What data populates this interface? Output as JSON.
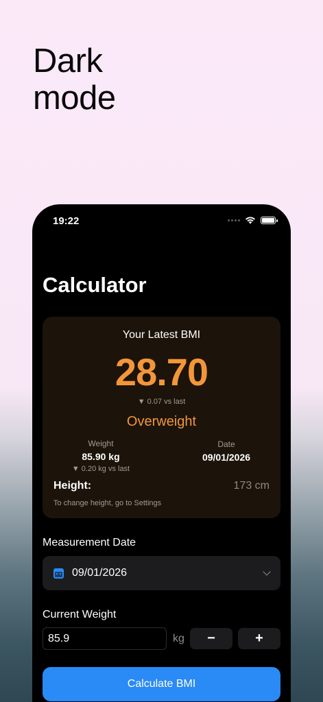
{
  "promo": {
    "line1": "Dark",
    "line2": "mode"
  },
  "status_bar": {
    "time": "19:22"
  },
  "screen": {
    "title": "Calculator"
  },
  "bmi_card": {
    "heading": "Your Latest BMI",
    "value": "28.70",
    "delta": "▼ 0.07 vs last",
    "category": "Overweight",
    "weight_label": "Weight",
    "weight_value": "85.90 kg",
    "weight_delta": "▼ 0.20 kg vs last",
    "date_label": "Date",
    "date_value": "09/01/2026",
    "height_label": "Height:",
    "height_value": "173 cm",
    "note": "To change height, go to Settings"
  },
  "measurement_date": {
    "label": "Measurement Date",
    "value": "09/01/2026",
    "icon": "calendar-icon"
  },
  "current_weight": {
    "label": "Current Weight",
    "value": "85.9",
    "unit": "kg",
    "minus": "−",
    "plus": "+"
  },
  "calculate_button": {
    "label": "Calculate BMI"
  },
  "colors": {
    "accent": "#2a8af6",
    "bmi_orange": "#f3963a",
    "card_bg": "#1c140b"
  }
}
